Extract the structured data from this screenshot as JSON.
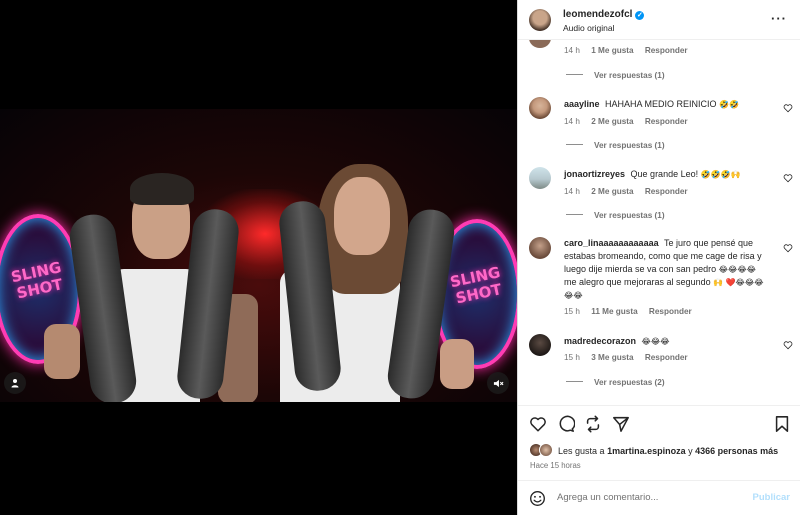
{
  "header": {
    "username": "leomendezofcl",
    "audio": "Audio original"
  },
  "video": {
    "sign_left": "SLING\nSHOT",
    "sign_right": "SLING\nSHOT"
  },
  "comments": [
    {
      "username": "",
      "text": "",
      "time": "14 h",
      "likes": "1 Me gusta",
      "reply": "Responder",
      "view_replies": "Ver respuestas (1)"
    },
    {
      "username": "aaayline",
      "text": "HAHAHA MEDIO REINICIO",
      "emoji": "🤣🤣",
      "time": "14 h",
      "likes": "2 Me gusta",
      "reply": "Responder",
      "view_replies": "Ver respuestas (1)"
    },
    {
      "username": "jonaortizreyes",
      "text": "Que grande Leo!",
      "emoji": "🤣🤣🤣🙌",
      "time": "14 h",
      "likes": "2 Me gusta",
      "reply": "Responder",
      "view_replies": "Ver respuestas (1)"
    },
    {
      "username": "caro_linaaaaaaaaaaaa",
      "text": "Te juro que pensé que estabas bromeando, como que me cage de risa y luego dije mierda se va con san pedro",
      "emoji_1": "😂😂😂😂",
      "text_2": "me alegro que mejoraras al segundo",
      "emoji_2": "🙌",
      "emoji_3": "❤️😂😂😂😂😂",
      "time": "15 h",
      "likes": "11 Me gusta",
      "reply": "Responder"
    },
    {
      "username": "madredecorazon",
      "text": "",
      "emoji": "😂😂😂",
      "time": "15 h",
      "likes": "3 Me gusta",
      "reply": "Responder",
      "view_replies": "Ver respuestas (2)"
    }
  ],
  "likes_line": {
    "prefix": "Les gusta a",
    "user": "1martina.espinoza",
    "connector": "y",
    "count": "4366 personas más"
  },
  "time_ago": "Hace 15 horas",
  "add_comment": {
    "placeholder": "Agrega un comentario...",
    "publish": "Publicar"
  },
  "icons": [
    "heart-icon",
    "comment-icon",
    "share-icon",
    "send-icon",
    "bookmark-icon",
    "emoji-icon",
    "more-icon",
    "mute-icon",
    "user-tag-icon",
    "verified-icon"
  ],
  "colors": {
    "accent": "#0095f6",
    "publish_disabled": "#b2dffc",
    "text": "#262626",
    "muted": "#737373"
  }
}
